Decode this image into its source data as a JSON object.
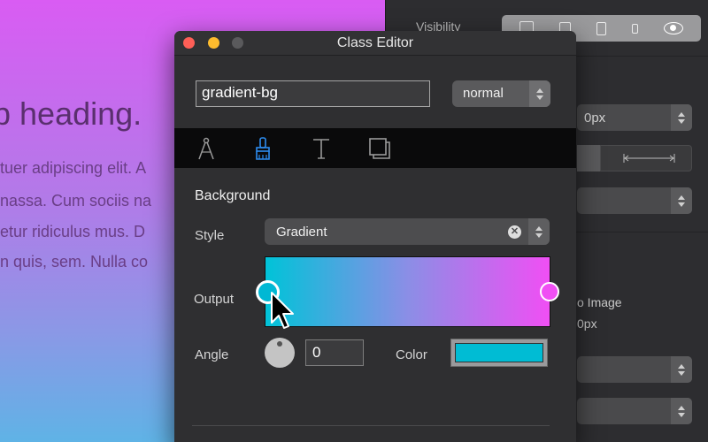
{
  "canvas": {
    "heading": "b heading.",
    "paragraph_lines": [
      "tuer adipiscing elit. A",
      "nassa. Cum sociis na",
      "etur ridiculus mus. D",
      "n quis, sem. Nulla co"
    ]
  },
  "inspector": {
    "visibility_label": "Visibility",
    "field_1_value": "0px",
    "image_label": "o Image",
    "image_size": "0px"
  },
  "editor": {
    "title": "Class Editor",
    "class_name_value": "gradient-bg",
    "state_select_value": "normal",
    "tabs": [
      {
        "icon": "compass-icon",
        "active": false
      },
      {
        "icon": "paintbrush-icon",
        "active": true
      },
      {
        "icon": "text-icon",
        "active": false
      },
      {
        "icon": "layers-icon",
        "active": false
      }
    ],
    "background_section_title": "Background",
    "style_label": "Style",
    "style_value": "Gradient",
    "output_label": "Output",
    "angle_label": "Angle",
    "angle_value": "0",
    "color_label": "Color",
    "colors": {
      "gradient_start": "#00c3d8",
      "gradient_end": "#f04ff4",
      "selected_color": "#00bcd4"
    }
  }
}
